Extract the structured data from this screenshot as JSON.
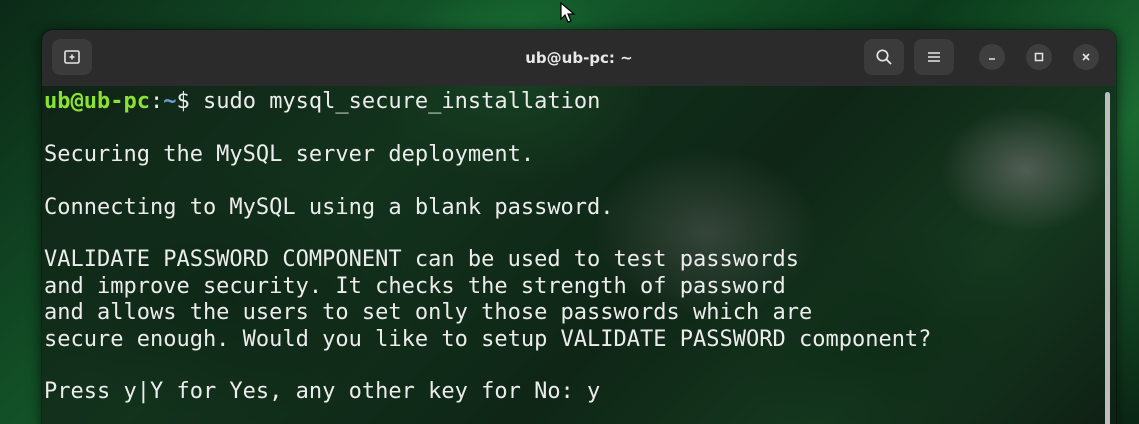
{
  "window": {
    "title": "ub@ub-pc: ~"
  },
  "titlebar": {
    "new_tab_icon": "new-tab-icon",
    "search_icon": "search-icon",
    "menu_icon": "hamburger-menu-icon",
    "minimize_icon": "minimize-icon",
    "maximize_icon": "maximize-icon",
    "close_icon": "close-icon"
  },
  "terminal": {
    "prompt": {
      "user_host": "ub@ub-pc",
      "separator": ":",
      "path": "~",
      "symbol": "$",
      "command": " sudo mysql_secure_installation"
    },
    "lines": [
      "",
      "Securing the MySQL server deployment.",
      "",
      "Connecting to MySQL using a blank password.",
      "",
      "VALIDATE PASSWORD COMPONENT can be used to test passwords",
      "and improve security. It checks the strength of password",
      "and allows the users to set only those passwords which are",
      "secure enough. Would you like to setup VALIDATE PASSWORD component?",
      "",
      "Press y|Y for Yes, any other key for No: y"
    ]
  },
  "colors": {
    "titlebar": "#2b2b2b",
    "prompt_user": "#8ae234",
    "prompt_path": "#729fcf",
    "text": "#ececec"
  }
}
